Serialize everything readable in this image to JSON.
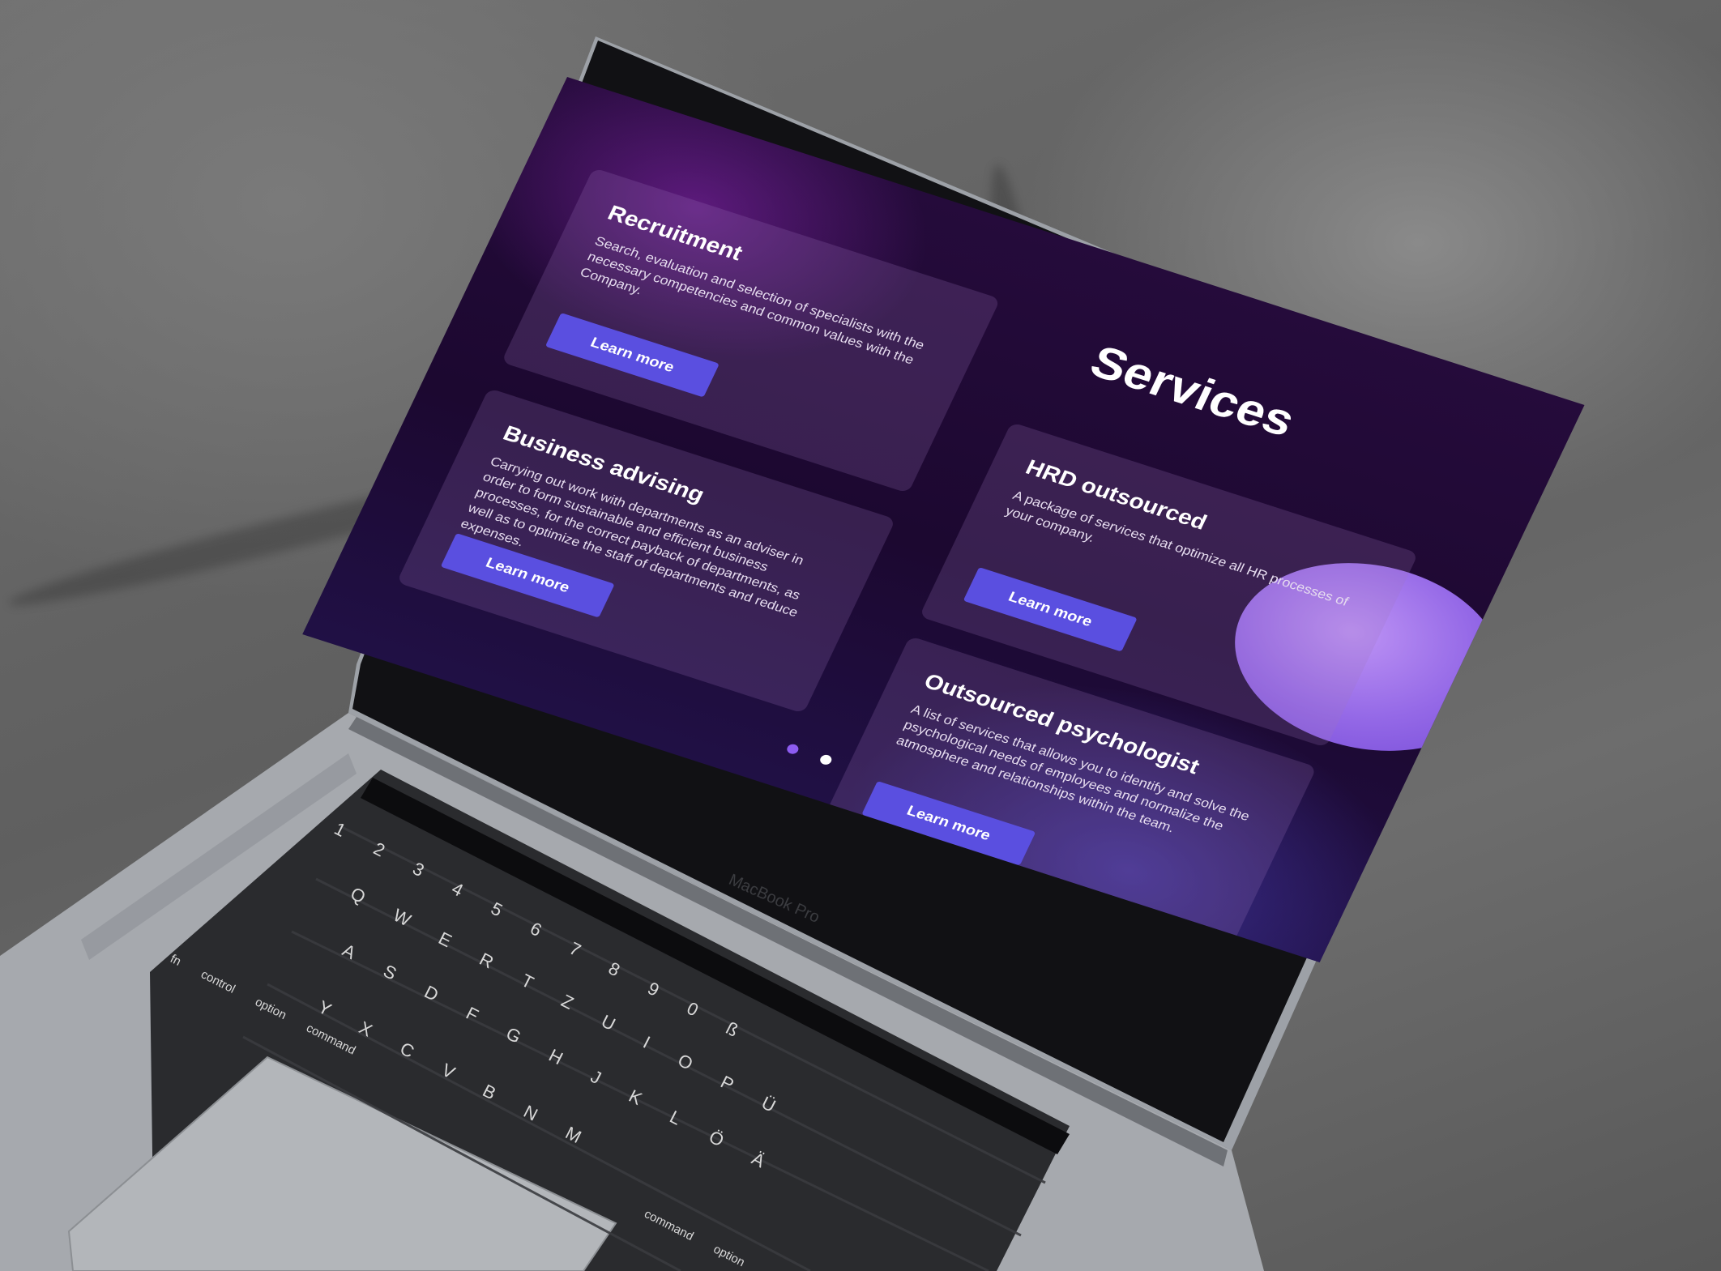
{
  "page": {
    "title": "Services"
  },
  "cards": [
    {
      "title": "Recruitment",
      "description": "Search, evaluation and selection of specialists with the necessary competencies and common values with the Company.",
      "button_label": "Learn more"
    },
    {
      "title": "HRD outsourced",
      "description": "A package of services that optimize all HR processes of your company.",
      "button_label": "Learn more"
    },
    {
      "title": "Business advising",
      "description": "Carrying out work with departments as an adviser in order to form sustainable and efficient business processes, for the correct payback of departments, as well as to optimize the staff of departments and reduce expenses.",
      "button_label": "Learn more"
    },
    {
      "title": "Outsourced psychologist",
      "description": "A list of services that allows you to identify and solve the psychological needs of employees and normalize the atmosphere and relationships within the team.",
      "button_label": "Learn more"
    }
  ],
  "carousel": {
    "total": 2,
    "active_index": 0
  },
  "device": {
    "label": "MacBook Pro"
  },
  "keyboard": {
    "keys_row1": [
      "1",
      "2",
      "3",
      "4",
      "5",
      "6",
      "7",
      "8",
      "9",
      "0",
      "ß"
    ],
    "keys_row2": [
      "Q",
      "W",
      "E",
      "R",
      "T",
      "Z",
      "U",
      "I",
      "O",
      "P",
      "Ü"
    ],
    "keys_row3": [
      "A",
      "S",
      "D",
      "F",
      "G",
      "H",
      "J",
      "K",
      "L",
      "Ö",
      "Ä"
    ],
    "keys_row4": [
      "Y",
      "X",
      "C",
      "V",
      "B",
      "N",
      "M"
    ],
    "modifiers": [
      "fn",
      "control",
      "option",
      "command",
      "command",
      "option"
    ]
  },
  "colors": {
    "accent_button": "#5a4fe0",
    "screen_bg": "#1c0830",
    "dot_active": "#8d5cf0",
    "dot_inactive": "#ffffff"
  }
}
